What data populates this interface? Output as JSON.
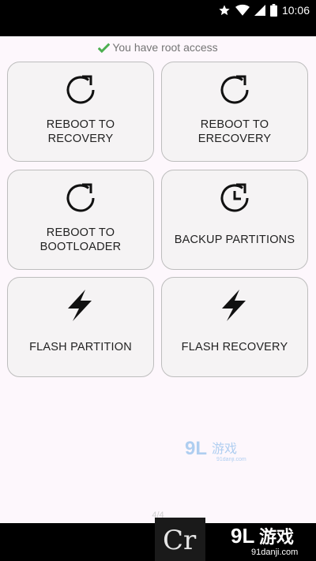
{
  "status_bar": {
    "time": "10:06",
    "icons": [
      "star-icon",
      "wifi-icon",
      "signal-icon",
      "battery-icon"
    ]
  },
  "root_status": {
    "icon": "checkmark-icon",
    "text": "You have root access",
    "check_color": "#4caf50"
  },
  "tiles": [
    {
      "label": "REBOOT TO RECOVERY",
      "icon": "refresh-icon"
    },
    {
      "label": "REBOOT TO ERECOVERY",
      "icon": "refresh-icon"
    },
    {
      "label": "REBOOT TO BOOTLOADER",
      "icon": "refresh-icon"
    },
    {
      "label": "BACKUP PARTITIONS",
      "icon": "clock-icon"
    },
    {
      "label": "FLASH PARTITION",
      "icon": "lightning-icon"
    },
    {
      "label": "FLASH RECOVERY",
      "icon": "lightning-icon"
    }
  ],
  "pager": {
    "text": "4/4"
  },
  "watermark": {
    "brand": "9L游戏",
    "url": "91danji.com",
    "logo_letters": "Cr"
  },
  "colors": {
    "status_bar_bg": "#000000",
    "page_bg": "#fdf7fc",
    "tile_bg": "#f5f3f4",
    "tile_border": "#bdbdbd",
    "text": "#222222",
    "watermark_blue": "#6aa6e6"
  }
}
